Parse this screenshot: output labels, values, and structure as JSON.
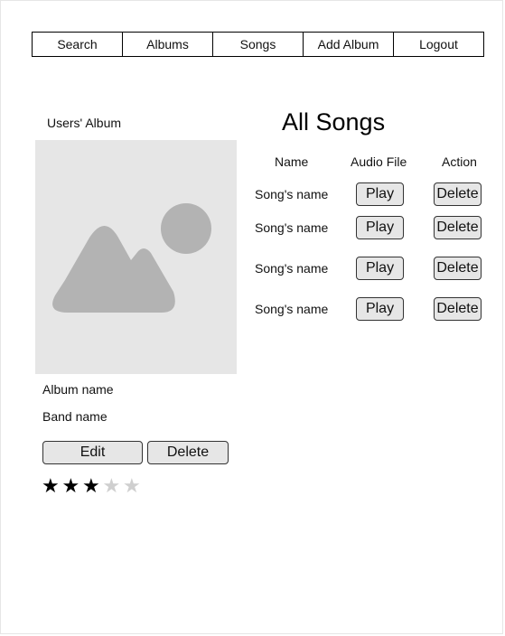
{
  "nav": {
    "items": [
      "Search",
      "Albums",
      "Songs",
      "Add Album",
      "Logout"
    ]
  },
  "album": {
    "heading": "Users' Album",
    "image_icon": "image-placeholder-icon",
    "name": "Album name",
    "band": "Band name",
    "edit_label": "Edit",
    "delete_label": "Delete",
    "rating": {
      "value": 3,
      "max": 5
    }
  },
  "songs": {
    "title": "All Songs",
    "columns": [
      "Name",
      "Audio File",
      "Action"
    ],
    "rows": [
      {
        "name": "Song's name",
        "play_label": "Play",
        "delete_label": "Delete"
      },
      {
        "name": "Song's name",
        "play_label": "Play",
        "delete_label": "Delete"
      },
      {
        "name": "Song's name",
        "play_label": "Play",
        "delete_label": "Delete"
      },
      {
        "name": "Song's name",
        "play_label": "Play",
        "delete_label": "Delete"
      }
    ]
  },
  "colors": {
    "button_bg": "#e6e6e6",
    "placeholder_bg": "#e6e6e6",
    "placeholder_shape": "#b3b3b3",
    "star_on": "#000000",
    "star_off": "#cfcfcf"
  }
}
